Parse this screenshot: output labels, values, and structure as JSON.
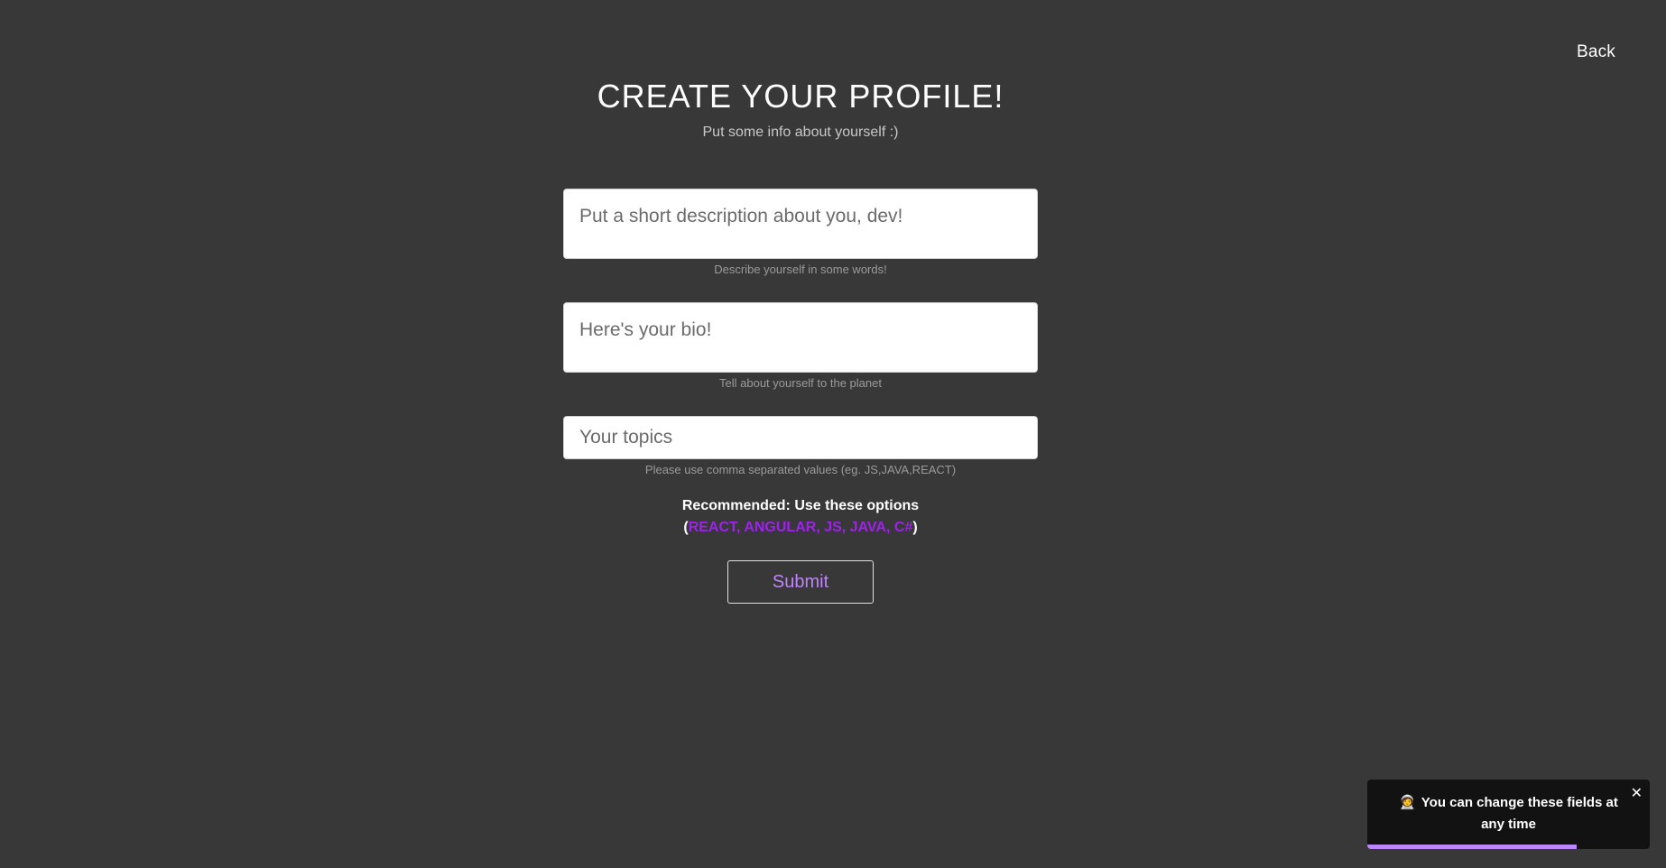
{
  "header": {
    "back_label": "Back"
  },
  "main": {
    "title": "CREATE YOUR PROFILE!",
    "subtitle": "Put some info about yourself :)"
  },
  "form": {
    "description": {
      "placeholder": "Put a short description about you, dev!",
      "hint": "Describe yourself in some words!"
    },
    "bio": {
      "placeholder": "Here's your bio!",
      "hint": "Tell about yourself to the planet"
    },
    "topics": {
      "placeholder": "Your topics",
      "hint": "Please use comma separated values (eg. JS,JAVA,REACT)"
    },
    "recommend_label": "Recommended: Use these options",
    "recommend_open": "(",
    "recommend_options": "REACT, ANGULAR, JS, JAVA, C#",
    "recommend_close": ")",
    "submit_label": "Submit"
  },
  "toast": {
    "icon": "astronaut-emoji",
    "emoji": "🧑‍🚀",
    "message": "You can change these fields at any time",
    "close_label": "✕",
    "progress": 0.74
  },
  "colors": {
    "background": "#383838",
    "accent": "#a020f0",
    "submit_text": "#c084fc",
    "toast_bg": "#121212",
    "toast_progress": "#bb86fc"
  }
}
